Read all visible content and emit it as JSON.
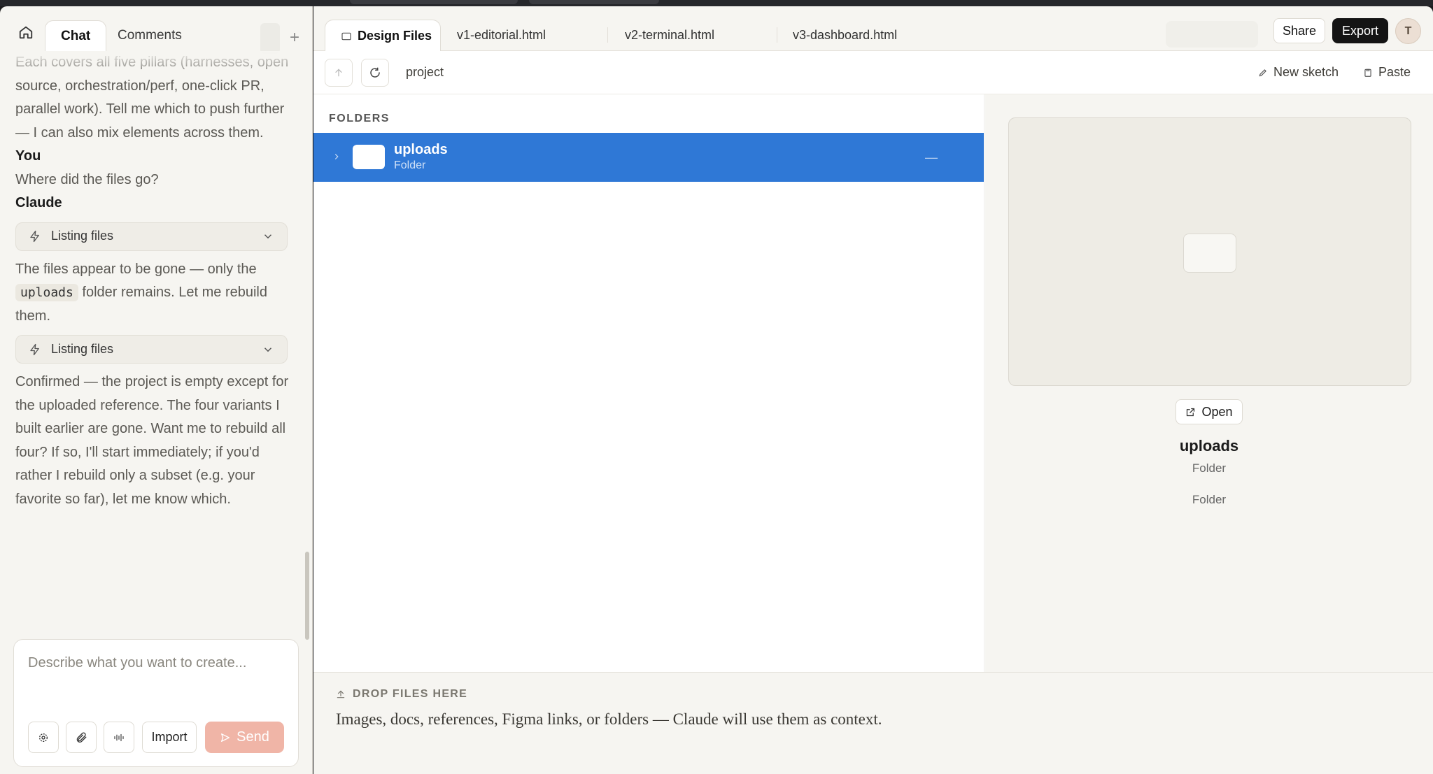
{
  "left_panel": {
    "tabs": [
      {
        "label": "Chat"
      },
      {
        "label": "Comments"
      }
    ],
    "messages": {
      "m1": "Each covers all five pillars (harnesses, open source, orchestration/perf, one-click PR, parallel work). Tell me which to push further — I can also mix elements across them.",
      "you_label": "You",
      "you_text": "Where did the files go?",
      "claude_label": "Claude",
      "tool1": "Listing files",
      "reply_a": "The files appear to be gone — only the",
      "reply_code": "uploads",
      "reply_b": "folder remains. Let me rebuild them.",
      "tool2": "Listing files",
      "final": "Confirmed — the project is empty except for the uploaded reference. The four variants I built earlier are gone. Want me to rebuild all four? If so, I'll start immediately; if you'd rather I rebuild only a subset (e.g. your favorite so far), let me know which."
    },
    "composer": {
      "placeholder": "Describe what you want to create...",
      "import_label": "Import",
      "send_label": "Send"
    }
  },
  "right_panel": {
    "tabs": [
      {
        "label": "Design Files"
      },
      {
        "label": "v1-editorial.html"
      },
      {
        "label": "v2-terminal.html"
      },
      {
        "label": "v3-dashboard.html"
      }
    ],
    "share_label": "Share",
    "export_label": "Export",
    "avatar_initial": "T",
    "path": "project",
    "new_sketch_label": "New sketch",
    "paste_label": "Paste",
    "folders_header": "FOLDERS",
    "rows": [
      {
        "name": "uploads",
        "type": "Folder",
        "meta": "—"
      }
    ],
    "preview": {
      "open_label": "Open",
      "name": "uploads",
      "type": "Folder",
      "kind": "Folder"
    },
    "drop": {
      "title": "DROP FILES HERE",
      "description": "Images, docs, references, Figma links, or folders — Claude will use them as context."
    }
  },
  "colors": {
    "accent": "#2f78d6",
    "send": "#f0b5a7",
    "export": "#141414",
    "panel_bg": "#f6f5f1"
  }
}
